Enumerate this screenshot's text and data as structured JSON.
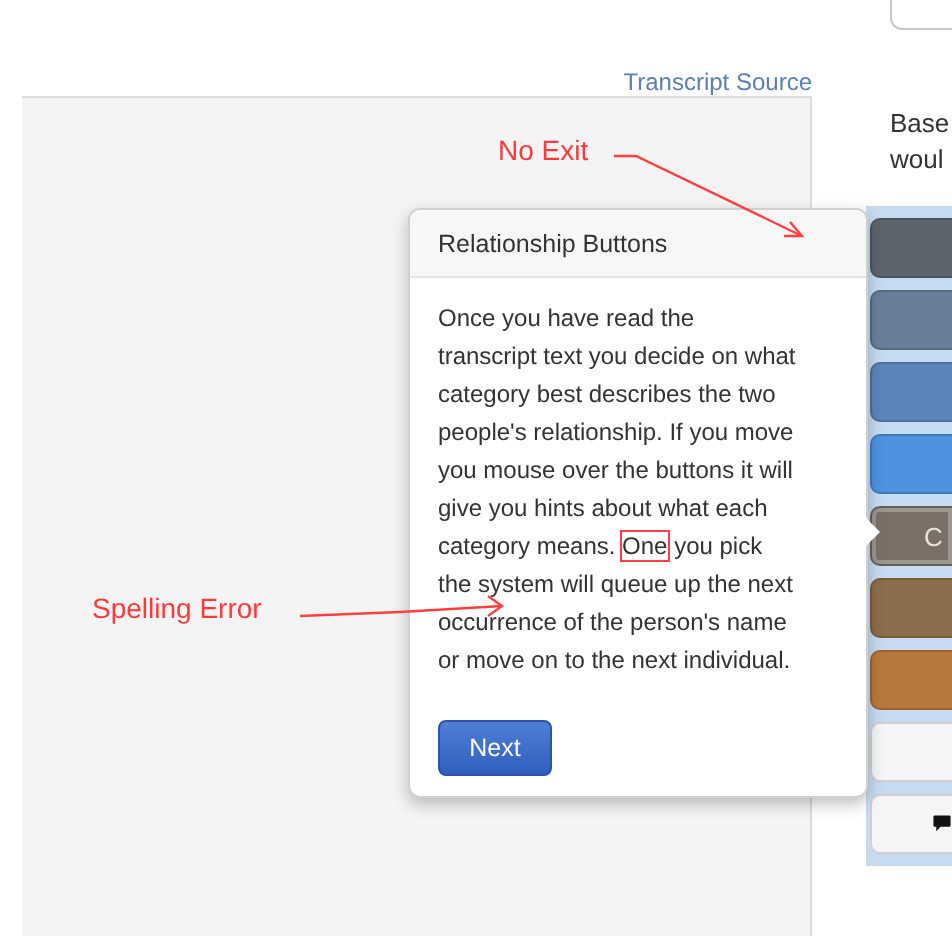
{
  "source_link": "Transcript Source",
  "question_lines": [
    "Base",
    "woul"
  ],
  "popover": {
    "title": "Relationship Buttons",
    "body": [
      {
        "text": "Once you have read the transcript text you decide on what category best describes the two people's relationship. If you move you mouse over the buttons it will give you hints about what each category means. ",
        "marked": false
      },
      {
        "text": "One",
        "marked": true
      },
      {
        "text": " you pick the system will queue up the next occurrence of the person's name or move on to the next individual.",
        "marked": false
      }
    ],
    "button": "Next"
  },
  "category_buttons": [
    {
      "kind": "plain",
      "color": "#5e646c"
    },
    {
      "kind": "plain",
      "color": "#697e98"
    },
    {
      "kind": "plain",
      "color": "#5a85bb"
    },
    {
      "kind": "plain",
      "color": "#4c92de"
    },
    {
      "kind": "label",
      "color": "#7b7067",
      "label": "C",
      "selected": true
    },
    {
      "kind": "plain",
      "color": "#8c6d4c"
    },
    {
      "kind": "plain",
      "color": "#b6793b"
    },
    {
      "kind": "plain",
      "color": "#f5f5f5"
    },
    {
      "kind": "icon",
      "color": "#f5f5f5"
    }
  ],
  "annotations": [
    {
      "kind": "arrow",
      "text": "No Exit"
    },
    {
      "kind": "arrow",
      "text": "Spelling Error"
    }
  ]
}
